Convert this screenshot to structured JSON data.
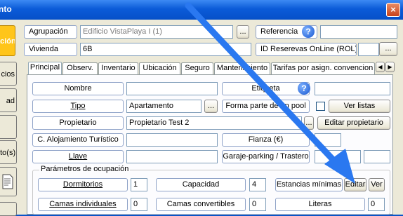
{
  "window": {
    "title": "nto",
    "close_label": "×"
  },
  "side_buttons": [
    {
      "label": "ación",
      "active": true
    },
    {
      "label": "cios",
      "active": false
    },
    {
      "label": "ad",
      "active": false
    },
    {
      "label": "",
      "active": false
    },
    {
      "label": "nto(s)",
      "active": false
    },
    {
      "label": "",
      "active": false
    }
  ],
  "header": {
    "agrupacion_label": "Agrupación",
    "agrupacion_value": "Edificio VistaPlaya I (1)",
    "agrupacion_button": "...",
    "referencia_label": "Referencia",
    "referencia_value": "",
    "vivienda_label": "Vivienda",
    "vivienda_value": "6B",
    "id_reservas_label": "ID Reserevas OnLine (ROL)",
    "id_reservas_value": "",
    "id_reservas_button": "..."
  },
  "tabs": [
    "Principal",
    "Observ.",
    "Inventario",
    "Ubicación",
    "Seguro",
    "Mantenimiento",
    "Tarifas por asign. convencion"
  ],
  "tab_scroll": {
    "left": "◀",
    "right": "▶"
  },
  "form": {
    "nombre_label": "Nombre",
    "nombre_value": "",
    "etiqueta_label": "Etiqueta",
    "etiqueta_value": "",
    "tipo_label": "Tipo",
    "tipo_value": "Apartamento",
    "tipo_button": "...",
    "forma_parte_label": "Forma parte de un pool",
    "ver_listas_button": "Ver listas",
    "propietario_label": "Propietario",
    "propietario_value": "Propietario Test 2",
    "propietario_button": "...",
    "editar_propietario_button": "Editar propietario",
    "alojamiento_label": "C. Alojamiento Turístico",
    "alojamiento_value": "",
    "fianza_label": "Fianza (€)",
    "fianza_value": "",
    "llave_label": "Llave",
    "llave_value": "",
    "garaje_label": "Garaje-parking / Trastero",
    "garaje_value_1": "",
    "garaje_value_2": ""
  },
  "ocupacion": {
    "title": "Parámetros de ocupación",
    "dormitorios_label": "Dormitorios",
    "dormitorios_value": "1",
    "capacidad_label": "Capacidad",
    "capacidad_value": "4",
    "estancias_label": "Estancias mínimas",
    "editar_button": "Editar",
    "ver_button": "Ver",
    "camas_individuales_label": "Camas individuales",
    "camas_individuales_value": "0",
    "camas_convertibles_label": "Camas convertibles",
    "camas_convertibles_value": "0",
    "literas_label": "Literas",
    "literas_value": "0"
  },
  "icons": {
    "help": "help-icon",
    "arrow": "pointer-arrow-annotation"
  },
  "colors": {
    "title_bar": "#0b5bd8",
    "active_side": "#ffc51a",
    "window_bg": "#ece9d8",
    "arrow": "#2a78f0"
  }
}
